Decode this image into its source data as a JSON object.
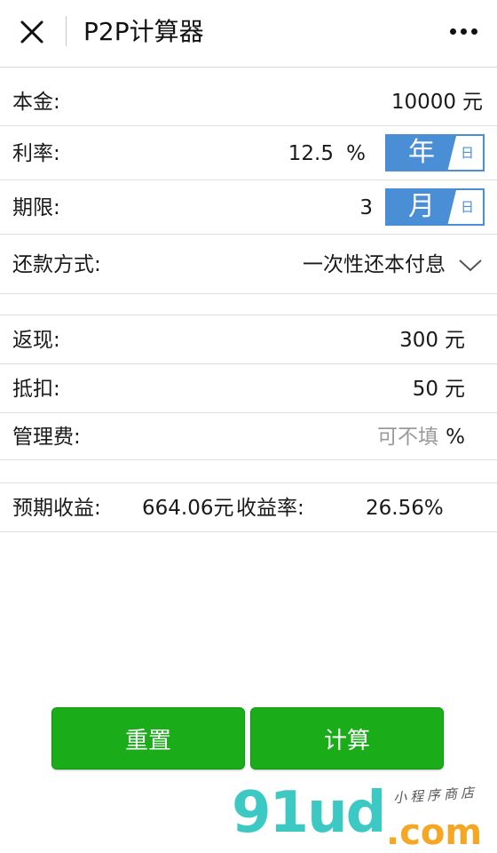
{
  "header": {
    "title": "P2P计算器",
    "close_icon": "close-icon",
    "more_icon": "more-dots-icon"
  },
  "form": {
    "principal": {
      "label": "本金:",
      "value": "10000",
      "unit": "元"
    },
    "rate": {
      "label": "利率:",
      "value": "12.5",
      "unit": "%",
      "toggle_on": "年",
      "toggle_off": "日"
    },
    "term": {
      "label": "期限:",
      "value": "3",
      "toggle_on": "月",
      "toggle_off": "日"
    },
    "repayment": {
      "label": "还款方式:",
      "value": "一次性还本付息"
    }
  },
  "extras": {
    "cashback": {
      "label": "返现:",
      "value": "300",
      "unit": "元"
    },
    "deduction": {
      "label": "抵扣:",
      "value": "50",
      "unit": "元"
    },
    "fee": {
      "label": "管理费:",
      "placeholder": "可不填",
      "unit": "%"
    }
  },
  "result": {
    "expected_label": "预期收益:",
    "expected_value": "664.06元",
    "rate_label": "收益率:",
    "rate_value": "26.56%"
  },
  "buttons": {
    "reset": "重置",
    "calculate": "计算"
  },
  "watermark": {
    "main": "91ud",
    "domain": ".com",
    "sub": "小程序商店"
  },
  "colors": {
    "primary_green": "#1aad19",
    "toggle_blue": "#4a8fd6"
  }
}
